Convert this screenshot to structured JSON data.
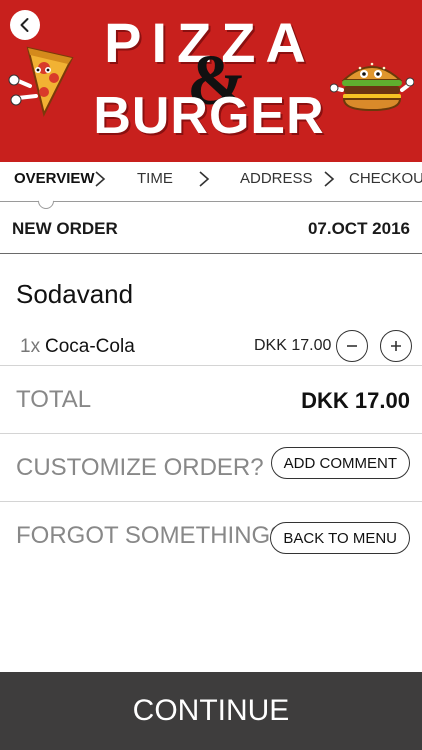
{
  "header": {
    "brand_top": "PIZZA",
    "brand_amp": "&",
    "brand_bottom": "BURGER",
    "icons": {
      "back": "back-arrow-icon",
      "pizza": "pizza-mascot-icon",
      "burger": "burger-mascot-icon"
    },
    "brand_color": "#c8201d"
  },
  "steps": {
    "items": [
      {
        "label": "OVERVIEW",
        "active": true
      },
      {
        "label": "TIME",
        "active": false
      },
      {
        "label": "ADDRESS",
        "active": false
      },
      {
        "label": "CHECKOUT",
        "active": false
      }
    ],
    "separator_icon": "chevron-right-icon"
  },
  "order": {
    "title": "NEW ORDER",
    "date": "07.OCT 2016",
    "category": "Sodavand",
    "items": [
      {
        "qty": "1x",
        "name": "Coca-Cola",
        "price": "DKK 17.00"
      }
    ],
    "total_label": "TOTAL",
    "total_value": "DKK 17.00"
  },
  "options": {
    "customize_label": "CUSTOMIZE ORDER?",
    "customize_button": "ADD COMMENT",
    "forgot_label": "FORGOT SOMETHING?",
    "forgot_button": "BACK TO MENU"
  },
  "footer": {
    "continue_label": "CONTINUE",
    "bar_color": "#3e3d3d"
  }
}
